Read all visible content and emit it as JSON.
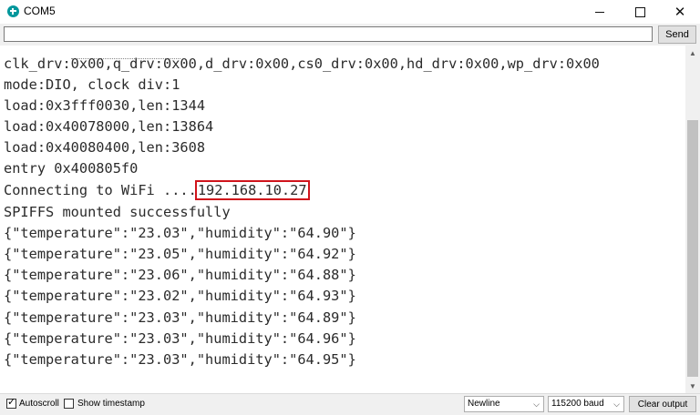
{
  "window": {
    "title": "COM5",
    "minimize": "—",
    "maximize": "☐",
    "close": "✕"
  },
  "send_bar": {
    "input_value": "",
    "send_label": "Send"
  },
  "output": {
    "partial_top_line": "    ",
    "lines": [
      "clk_drv:0x00,q_drv:0x00,d_drv:0x00,cs0_drv:0x00,hd_drv:0x00,wp_drv:0x00",
      "mode:DIO, clock div:1",
      "load:0x3fff0030,len:1344",
      "load:0x40078000,len:13864",
      "load:0x40080400,len:3608",
      "entry 0x400805f0",
      "SPIFFS mounted successfully",
      "{\"temperature\":\"23.03\",\"humidity\":\"64.90\"}",
      "{\"temperature\":\"23.05\",\"humidity\":\"64.92\"}",
      "{\"temperature\":\"23.06\",\"humidity\":\"64.88\"}",
      "{\"temperature\":\"23.02\",\"humidity\":\"64.93\"}",
      "{\"temperature\":\"23.03\",\"humidity\":\"64.89\"}",
      "{\"temperature\":\"23.03\",\"humidity\":\"64.96\"}",
      "{\"temperature\":\"23.03\",\"humidity\":\"64.95\"}"
    ],
    "wifi_prefix": "Connecting to WiFi ....",
    "ip_address": "192.168.10.27"
  },
  "bottom_bar": {
    "autoscroll_label": "Autoscroll",
    "autoscroll_checked": true,
    "timestamp_label": "Show timestamp",
    "timestamp_checked": false,
    "line_ending": "Newline",
    "baud_rate": "115200 baud",
    "clear_label": "Clear output"
  },
  "colors": {
    "highlight_box": "#d0141c",
    "arduino_teal": "#00979c"
  }
}
